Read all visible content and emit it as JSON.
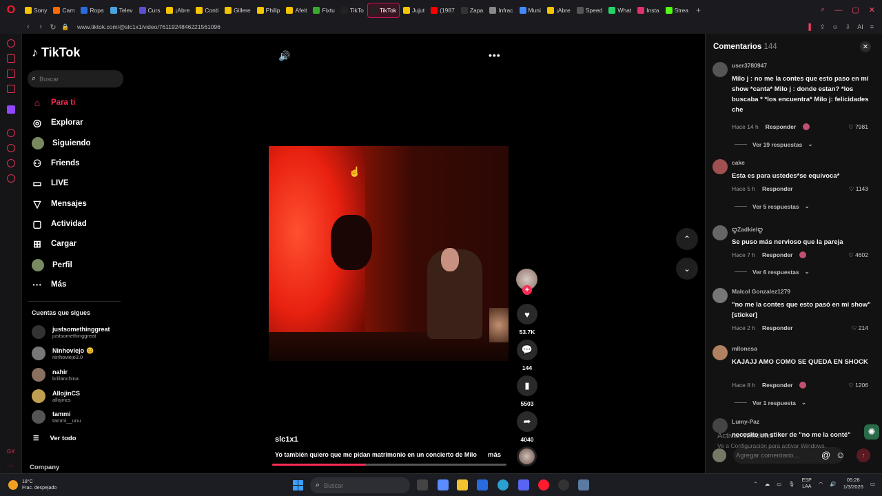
{
  "browser": {
    "tabs": [
      {
        "label": "Sony",
        "color": "#f5c400"
      },
      {
        "label": "Cam",
        "color": "#ff6a00"
      },
      {
        "label": "Ropa",
        "color": "#2a6adf"
      },
      {
        "label": "Telev",
        "color": "#4aa3df"
      },
      {
        "label": "Curs",
        "color": "#5a4fcf"
      },
      {
        "label": "¡Abre",
        "color": "#f5c400"
      },
      {
        "label": "Conti",
        "color": "#f5c400"
      },
      {
        "label": "Gillere",
        "color": "#f5c400"
      },
      {
        "label": "Philip",
        "color": "#f5c400"
      },
      {
        "label": "Afeit",
        "color": "#f5c400"
      },
      {
        "label": "Fixtu",
        "color": "#3aa830"
      },
      {
        "label": "TikTo",
        "color": "#222222"
      },
      {
        "label": "TikTok",
        "color": "#222222"
      },
      {
        "label": "Jujut",
        "color": "#f5c400"
      },
      {
        "label": "(1987",
        "color": "#ff0000"
      },
      {
        "label": "Zapa",
        "color": "#333333"
      },
      {
        "label": "Infrac",
        "color": "#888888"
      },
      {
        "label": "Muni",
        "color": "#4488ff"
      },
      {
        "label": "¡Abre",
        "color": "#f5c400"
      },
      {
        "label": "Speed",
        "color": "#555555"
      },
      {
        "label": "What",
        "color": "#25d366"
      },
      {
        "label": "Insta",
        "color": "#e1306c"
      },
      {
        "label": "Strea",
        "color": "#53fc18"
      }
    ],
    "active_tab_index": 12,
    "new_tab": "+",
    "url": "www.tiktok.com/@slc1x1/video/7611924846221561096",
    "aria_label": "AI"
  },
  "tiktok": {
    "logo": "TikTok",
    "search_placeholder": "Buscar",
    "nav": [
      {
        "label": "Para ti",
        "icon": "home-icon",
        "glyph": "⌂"
      },
      {
        "label": "Explorar",
        "icon": "compass-icon",
        "glyph": "◎"
      },
      {
        "label": "Siguiendo",
        "icon": "following-avatar-icon",
        "glyph": "●"
      },
      {
        "label": "Friends",
        "icon": "friends-icon",
        "glyph": "⚇"
      },
      {
        "label": "LIVE",
        "icon": "live-tv-icon",
        "glyph": "▭"
      },
      {
        "label": "Mensajes",
        "icon": "messages-icon",
        "glyph": "▽"
      },
      {
        "label": "Actividad",
        "icon": "activity-icon",
        "glyph": "▢"
      },
      {
        "label": "Cargar",
        "icon": "upload-icon",
        "glyph": "⊞"
      },
      {
        "label": "Perfil",
        "icon": "profile-avatar-icon",
        "glyph": "●"
      },
      {
        "label": "Más",
        "icon": "more-dots-icon",
        "glyph": "···"
      }
    ],
    "following_title": "Cuentas que sigues",
    "following": [
      {
        "name": "justsomethinggreat",
        "handle": "justsomethinggreat",
        "badge": ""
      },
      {
        "name": "Ninhoviejo",
        "handle": "ninhoviejo3.0",
        "badge": "😊"
      },
      {
        "name": "nahir",
        "handle": "brillanchina",
        "badge": ""
      },
      {
        "name": "AllojinCS",
        "handle": "allojincs",
        "badge": ""
      },
      {
        "name": "tammi",
        "handle": "tammi__unu",
        "badge": ""
      }
    ],
    "see_all": "Ver todo",
    "company": "Company"
  },
  "video": {
    "author": "slc1x1",
    "caption": "Yo también quiero que me pidan matrimonio en un concierto de Milo",
    "more": "más",
    "progress": 0.4,
    "likes": "53.7K",
    "comments": "144",
    "saves": "5503",
    "shares": "4040"
  },
  "comments": {
    "title": "Comentarios",
    "count": "144",
    "items": [
      {
        "user": "user3780947",
        "text": "Milo j : no me la contes que esto paso en mi show *canta* Milo j : donde estan? *los buscaba * *los encuentra* Milo j: felicidades che",
        "time": "Hace 14 h",
        "reply": "Responder",
        "likes": "7981",
        "replies": "Ver 19 respuestas"
      },
      {
        "user": "cake",
        "text": "Esta es para ustedes*se equivoca*",
        "time": "Hace 5 h",
        "reply": "Responder",
        "likes": "1143",
        "replies": "Ver 5 respuestas"
      },
      {
        "user": "ꨄZadkielꨄ",
        "text": "Se puso más nervioso que la pareja",
        "time": "Hace 7 h",
        "reply": "Responder",
        "likes": "4602",
        "replies": "Ver 6 respuestas"
      },
      {
        "user": "Malcol Gonzalez1279",
        "text": "\"no me la contes que esto pasó en mi show\" [sticker]",
        "time": "Hace 2 h",
        "reply": "Responder",
        "likes": "214",
        "replies": ""
      },
      {
        "user": "mllonesa",
        "text": "KAJAJJ AMO COMO SE QUEDA EN SHOCK",
        "time": "Hace 8 h",
        "reply": "Responder",
        "likes": "1206",
        "replies": "Ver 1 respuesta"
      },
      {
        "user": "Lumy-Paz",
        "text": "necesito un stiker de \"no me la conté\"",
        "time": "",
        "reply": "",
        "likes": "",
        "replies": ""
      }
    ],
    "input_placeholder": "Agregar comentario..."
  },
  "windows_watermark": {
    "line1": "Activar Windows",
    "line2": "Ve a Configuración para activar Windows."
  },
  "taskbar": {
    "weather_temp": "18°C",
    "weather_desc": "Frac. despejado",
    "search_placeholder": "Buscar",
    "lang1": "ESP",
    "lang2": "LAA",
    "time": "05:26",
    "date": "1/3/2026"
  }
}
